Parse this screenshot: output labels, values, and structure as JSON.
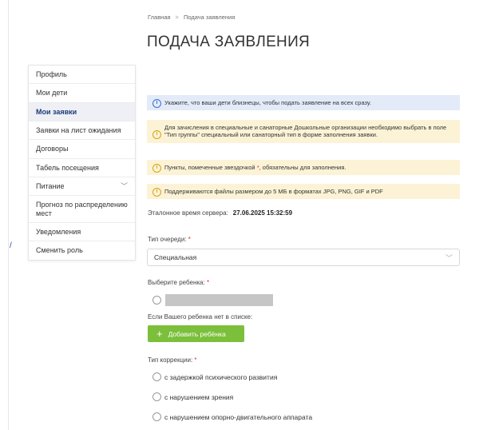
{
  "breadcrumb": {
    "home": "Главная",
    "separator": ">",
    "current": "Подача заявления"
  },
  "page_title": "ПОДАЧА ЗАЯВЛЕНИЯ",
  "sidebar": {
    "items": [
      {
        "label": "Профиль"
      },
      {
        "label": "Мои дети"
      },
      {
        "label": "Мои заявки",
        "active": true
      },
      {
        "label": "Заявки на лист ожидания"
      },
      {
        "label": "Договоры"
      },
      {
        "label": "Табель посещения"
      },
      {
        "label": "Питание",
        "has_submenu": true
      },
      {
        "label": "Прогноз по распределению мест"
      },
      {
        "label": "Уведомления"
      },
      {
        "label": "Сменить роль"
      }
    ]
  },
  "alerts": [
    {
      "type": "info",
      "text": "Укажите, что ваши дети близнецы, чтобы подать заявление на всех сразу."
    },
    {
      "type": "warn",
      "text": "Для зачисления в специальные и санаторные Дошкольные организации необходимо выбрать в поле \"Тип группы\" специальный или санаторный тип в форме заполнения заявки."
    },
    {
      "type": "warn",
      "text_before": "Пункты, помеченные звездочкой ",
      "star": "*",
      "text_after": ", обязательны для заполнения."
    },
    {
      "type": "warn",
      "text": "Поддерживаются файлы размером до 5 МБ в форматах JPG, PNG, GIF и PDF"
    }
  ],
  "server_time": {
    "label": "Эталонное время сервера:",
    "value": "27.06.2025 15:32:59"
  },
  "queue_type": {
    "label": "Тип очереди:",
    "required": "*",
    "value": "Специальная"
  },
  "child_select": {
    "label": "Выберите ребенка:",
    "required": "*",
    "not_found_text": "Если Вашего ребенка нет в списке:",
    "add_button_label": "Добавить ребёнка"
  },
  "correction_type": {
    "label": "Тип коррекции:",
    "required": "*",
    "options": [
      "с задержкой психического развития",
      "с нарушением зрения",
      "с нарушением опорно-двигательного аппарата"
    ]
  },
  "icons": {
    "info": "info-circle-icon",
    "plus": "plus-icon",
    "chevron": "chevron-down-icon"
  },
  "colors": {
    "accent_green": "#7bbf3a",
    "active_nav": "#1d3a7a",
    "info_bg": "#e3ebf9",
    "warn_bg": "#fcf3d6",
    "required": "#d9322b"
  }
}
